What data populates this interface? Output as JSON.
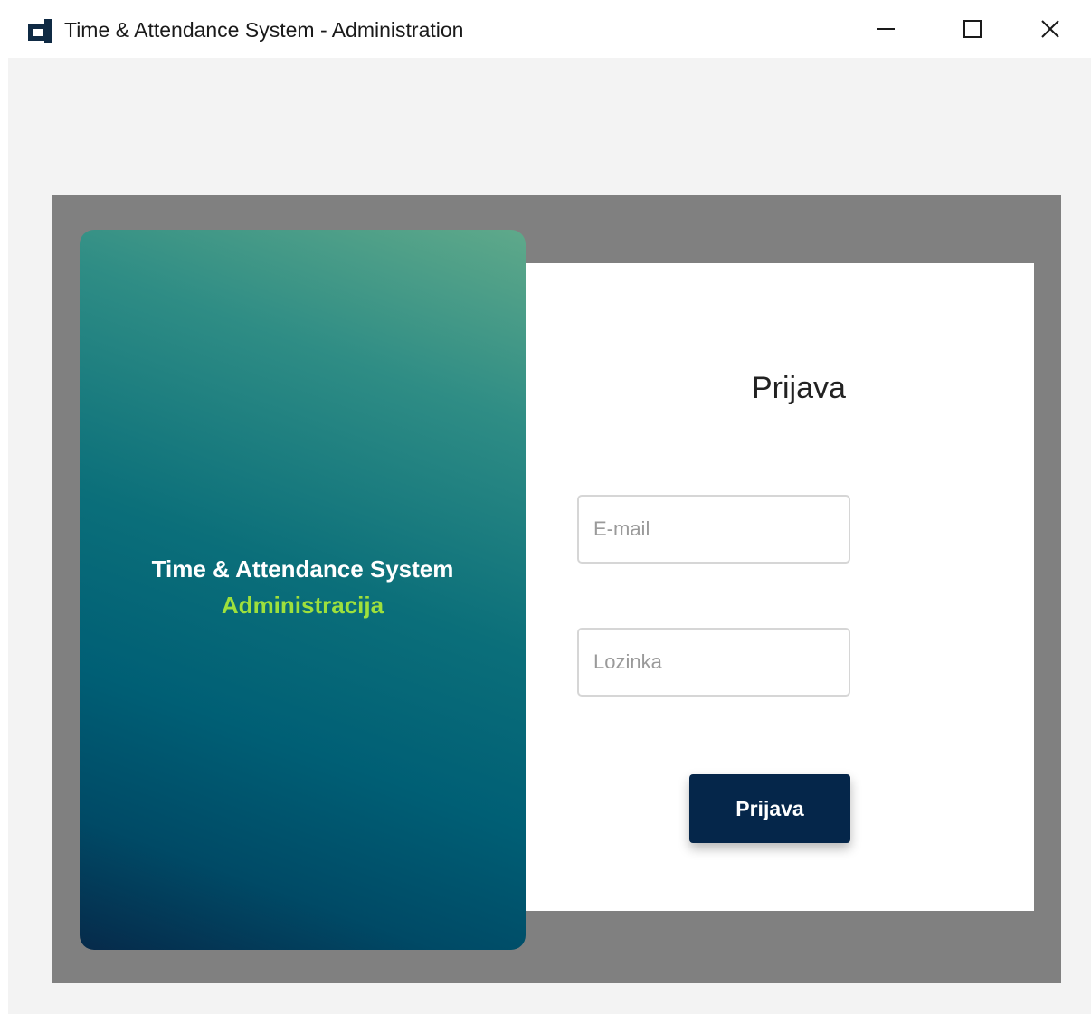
{
  "window": {
    "title": "Time & Attendance System - Administration",
    "icon": "app-logo-icon",
    "controls": {
      "minimize_icon": "minimize-icon",
      "maximize_icon": "maximize-icon",
      "close_icon": "close-icon"
    }
  },
  "brand_panel": {
    "title": "Time & Attendance System",
    "subtitle": "Administracija",
    "title_color": "#ffffff",
    "subtitle_color": "#9ee03c"
  },
  "login_form": {
    "heading": "Prijava",
    "email": {
      "placeholder": "E-mail",
      "value": ""
    },
    "password": {
      "placeholder": "Lozinka",
      "value": ""
    },
    "submit_label": "Prijava",
    "submit_color": "#05264a"
  }
}
